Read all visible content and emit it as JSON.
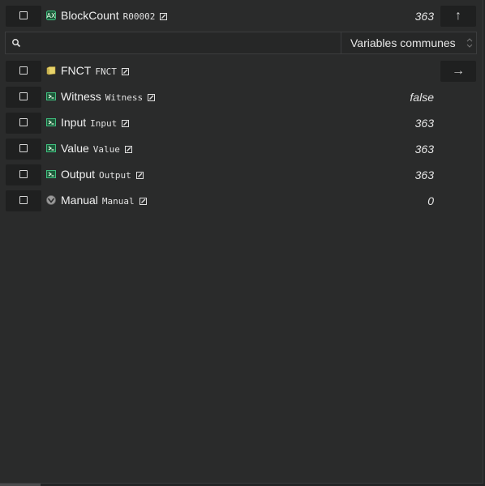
{
  "header": {
    "name": "BlockCount",
    "code": "R00002",
    "value": "363",
    "icon": "counter-block-icon",
    "nav_icon": "arrow-up-icon",
    "nav_glyph": "↑"
  },
  "search": {
    "value": "",
    "placeholder": ""
  },
  "scope_select": {
    "selected": "Variables communes"
  },
  "rows": [
    {
      "name": "FNCT",
      "code": "FNCT",
      "value": "",
      "icon": "folder-icon",
      "nav": true,
      "nav_icon": "arrow-right-icon",
      "nav_glyph": "→"
    },
    {
      "name": "Witness",
      "code": "Witness",
      "value": "false",
      "icon": "variable-icon"
    },
    {
      "name": "Input",
      "code": "Input",
      "value": "363",
      "icon": "variable-icon"
    },
    {
      "name": "Value",
      "code": "Value",
      "value": "363",
      "icon": "variable-icon"
    },
    {
      "name": "Output",
      "code": "Output",
      "value": "363",
      "icon": "variable-icon"
    },
    {
      "name": "Manual",
      "code": "Manual",
      "value": "0",
      "icon": "gauge-icon"
    }
  ],
  "colors": {
    "background": "#2a2b2b",
    "cell": "#1f2020",
    "accent_green": "#3fbf7f",
    "folder_yellow": "#e8d36a"
  }
}
